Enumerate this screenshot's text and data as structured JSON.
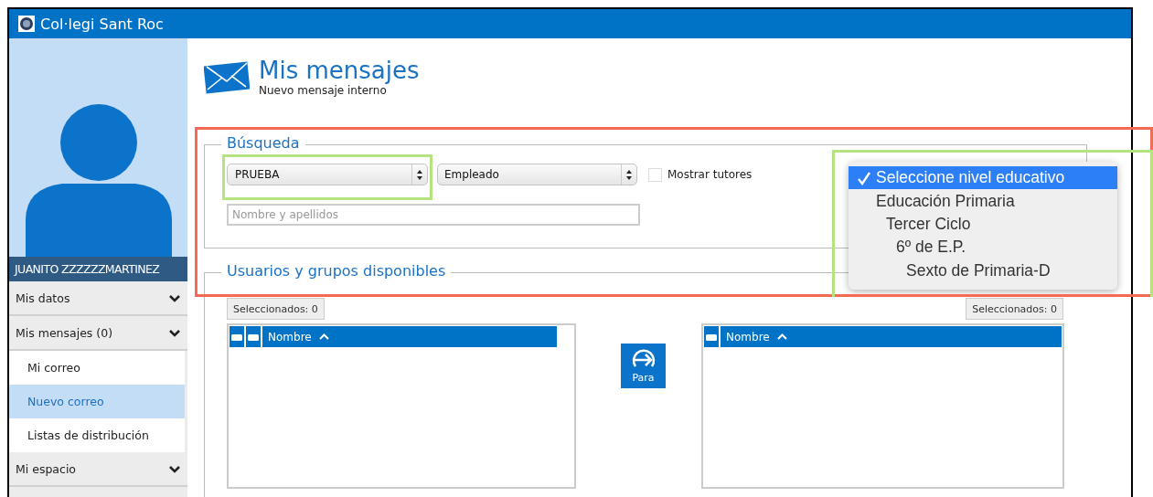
{
  "header": {
    "title": "Col·legi Sant Roc"
  },
  "sidebar": {
    "user_name": "JUANITO ZZZZZZMARTINEZ",
    "items": [
      {
        "label": "Mis datos"
      },
      {
        "label": "Mis mensajes (0)",
        "children": [
          {
            "label": "Mi correo",
            "selected": false
          },
          {
            "label": "Nuevo correo",
            "selected": true
          },
          {
            "label": "Listas de distribución",
            "selected": false
          }
        ]
      },
      {
        "label": "Mi espacio"
      }
    ]
  },
  "page": {
    "title": "Mis mensajes",
    "subtitle": "Nuevo mensaje interno"
  },
  "search": {
    "legend": "Búsqueda",
    "selects": [
      "PRUEBA",
      "Empleado"
    ],
    "show_tutors": {
      "label": "Mostrar tutores",
      "checked": false
    },
    "name_field": {
      "placeholder": "Nombre y apellidos"
    }
  },
  "available": {
    "legend": "Usuarios y grupos disponibles",
    "left_selected": "Seleccionados: 0",
    "right_selected": "Seleccionados: 0",
    "left_list": {
      "column": "Nombre"
    },
    "right_list": {
      "column": "Nombre"
    },
    "to_button": "Para"
  },
  "level_menu": {
    "items": [
      {
        "label": "Seleccione nivel educativo",
        "selected": true
      },
      {
        "label": "Educación Primaria",
        "selected": false,
        "children": [
          {
            "label": "Tercer Ciclo",
            "selected": false,
            "children": [
              {
                "label": "6º de E.P.",
                "selected": false,
                "children": [
                  {
                    "label": "Sexto de Primaria-D",
                    "selected": false
                  }
                ]
              }
            ]
          }
        ]
      }
    ]
  }
}
